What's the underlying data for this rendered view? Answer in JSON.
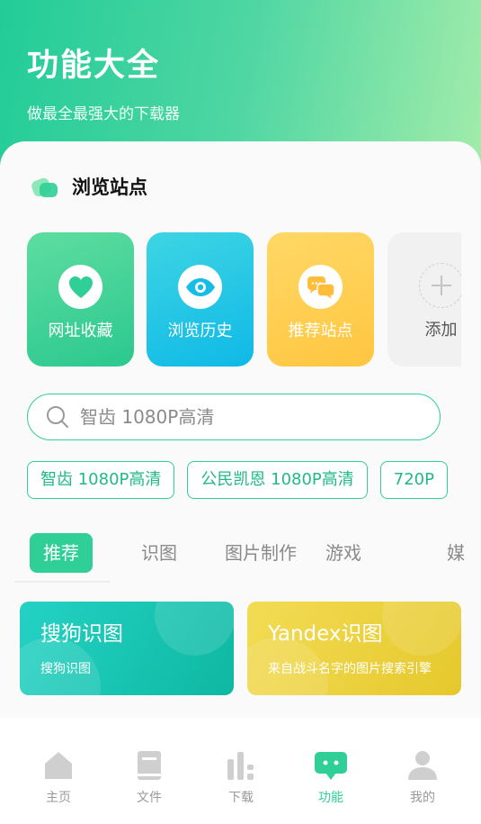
{
  "header": {
    "title": "功能大全",
    "subtitle": "做最全最强大的下载器"
  },
  "browse_section": {
    "title": "浏览站点",
    "quick_actions": [
      {
        "label": "网址收藏",
        "icon": "heart-icon",
        "color": "#2fcf97"
      },
      {
        "label": "浏览历史",
        "icon": "eye-icon",
        "color": "#16bde6"
      },
      {
        "label": "推荐站点",
        "icon": "chat-bubbles-icon",
        "color": "#ffcc4d"
      },
      {
        "label": "添加",
        "icon": "plus-icon",
        "color": "#f1f1f1"
      }
    ]
  },
  "search": {
    "placeholder": "智齿 1080P高清"
  },
  "suggestions": [
    "智齿 1080P高清",
    "公民凯恩 1080P高清",
    "720P"
  ],
  "category_tabs": [
    {
      "label": "推荐",
      "active": true
    },
    {
      "label": "识图",
      "active": false
    },
    {
      "label": "图片制作",
      "active": false
    },
    {
      "label": "游戏",
      "active": false
    },
    {
      "label": "媒",
      "active": false
    }
  ],
  "cards": [
    {
      "title": "搜狗识图",
      "subtitle": "搜狗识图",
      "color": "#1cc7b6"
    },
    {
      "title": "Yandex识图",
      "subtitle": "来自战斗名字的图片搜索引擎",
      "color": "#ecd03d"
    }
  ],
  "bottom_nav": [
    {
      "label": "主页",
      "icon": "home-icon",
      "active": false
    },
    {
      "label": "文件",
      "icon": "file-icon",
      "active": false
    },
    {
      "label": "下载",
      "icon": "download-bars-icon",
      "active": false
    },
    {
      "label": "功能",
      "icon": "feature-chat-icon",
      "active": true
    },
    {
      "label": "我的",
      "icon": "user-icon",
      "active": false
    }
  ],
  "colors": {
    "accent": "#2fcf97",
    "inactive": "#999999"
  }
}
